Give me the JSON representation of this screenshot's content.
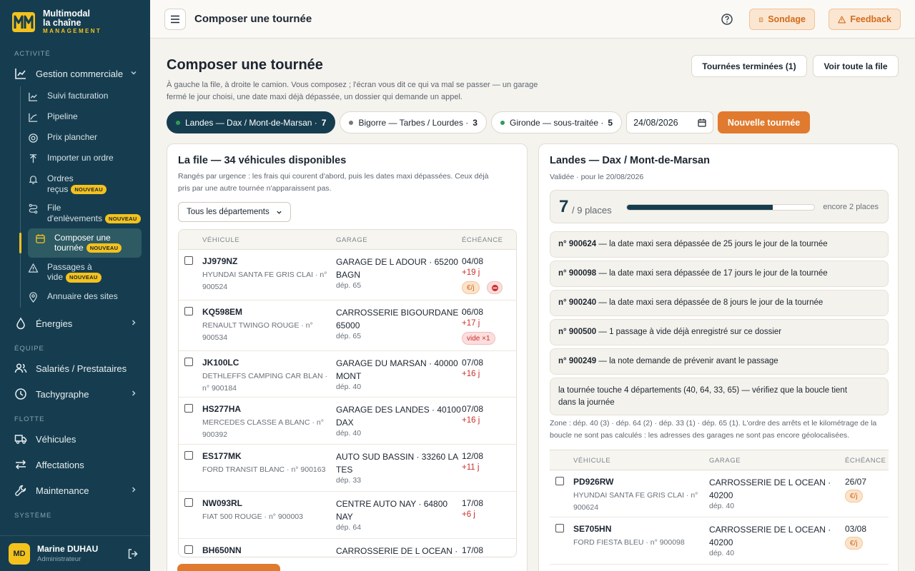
{
  "brand": {
    "name_line1": "Multimodal",
    "name_line2": "la chaîne",
    "sub": "MANAGEMENT",
    "logo_text": "MM"
  },
  "sidebar": {
    "sections": {
      "activite": "ACTIVITÉ",
      "equipe": "ÉQUIPE",
      "flotte": "FLOTTE",
      "systeme": "SYSTÈME"
    },
    "gestion": "Gestion commerciale",
    "sub_items": [
      {
        "label": "Suivi facturation",
        "icon": "chart-line-icon"
      },
      {
        "label": "Pipeline",
        "icon": "trend-icon"
      },
      {
        "label": "Prix plancher",
        "icon": "target-icon"
      },
      {
        "label": "Importer un ordre",
        "icon": "upload-icon"
      },
      {
        "label_line1": "Ordres",
        "label_line2": "reçus",
        "badge": "NOUVEAU",
        "icon": "bell-icon"
      },
      {
        "label_line1": "File",
        "label_line2": "d'enlèvements",
        "badge": "NOUVEAU",
        "icon": "route-icon"
      },
      {
        "label_line1": "Composer une",
        "label_line2": "tournée",
        "badge": "NOUVEAU",
        "icon": "calendar-icon"
      },
      {
        "label_line1": "Passages à",
        "label_line2": "vide",
        "badge": "NOUVEAU",
        "icon": "warning-icon"
      },
      {
        "label": "Annuaire des sites",
        "icon": "pin-icon"
      }
    ],
    "energies": "Énergies",
    "salaries": "Salariés / Prestataires",
    "tachygraphe": "Tachygraphe",
    "vehicules": "Véhicules",
    "affectations": "Affectations",
    "maintenance": "Maintenance"
  },
  "user": {
    "initials": "MD",
    "name": "Marine DUHAU",
    "role": "Administrateur"
  },
  "topbar": {
    "title": "Composer une tournée",
    "sondage": "Sondage",
    "feedback": "Feedback"
  },
  "page": {
    "title": "Composer une tournée",
    "desc": "À gauche la file, à droite le camion. Vous composez ; l'écran vous dit ce qui va mal se passer — un garage fermé le jour choisi, une date maxi déjà dépassée, un dossier qui demande un appel.",
    "btn_terminees": "Tournées terminées (1)",
    "btn_file": "Voir toute la file",
    "chips": [
      {
        "label": "Landes — Dax / Mont-de-Marsan ·",
        "count": "7",
        "dot": "#2e9d5b"
      },
      {
        "label": "Bigorre — Tarbes / Lourdes ·",
        "count": "3",
        "dot": "#777777"
      },
      {
        "label": "Gironde — sous-traitée ·",
        "count": "5",
        "dot": "#2e9d5b"
      }
    ],
    "date": "24/08/2026",
    "new_btn": "Nouvelle tournée"
  },
  "queue": {
    "title": "La file — 34 véhicules disponibles",
    "sub_line1": "Rangés par urgence : les frais qui courent d'abord, puis les dates maxi dépassées. Ceux déjà",
    "sub_line2": "pris par une autre tournée n'apparaissent pas.",
    "filter": "Tous les départements",
    "headers": {
      "vehicle": "VÉHICULE",
      "garage": "GARAGE",
      "due": "ÉCHÉANCE"
    },
    "rows": [
      {
        "plate": "JJ979NZ",
        "desc1": "HYUNDAI SANTA FE GRIS CLAI · n°",
        "desc2": "900524",
        "garage1": "GARAGE DE L ADOUR · 65200",
        "garage2": "BAGN",
        "dep": "dép. 65",
        "date": "04/08",
        "late": "+19 j",
        "badges": [
          "€/j",
          "stop"
        ]
      },
      {
        "plate": "KQ598EM",
        "desc1": "RENAULT TWINGO ROUGE · n°",
        "desc2": "900534",
        "garage1": "CARROSSERIE BIGOURDANE ·",
        "garage2": "65000",
        "dep": "dép. 65",
        "date": "06/08",
        "late": "+17 j",
        "badges": [
          "vide ×1"
        ]
      },
      {
        "plate": "JK100LC",
        "desc1": "DETHLEFFS CAMPING CAR BLAN ·",
        "desc2": "n° 900184",
        "garage1": "GARAGE DU MARSAN · 40000",
        "garage2": "MONT",
        "dep": "dép. 40",
        "date": "07/08",
        "late": "+16 j",
        "badges": []
      },
      {
        "plate": "HS277HA",
        "desc1": "MERCEDES CLASSE A BLANC · n°",
        "desc2": "900392",
        "garage1": "GARAGE DES LANDES · 40100",
        "garage2": "DAX",
        "dep": "dép. 40",
        "date": "07/08",
        "late": "+16 j",
        "badges": []
      },
      {
        "plate": "ES177MK",
        "desc1": "FORD TRANSIT BLANC · n° 900163",
        "desc2": "",
        "garage1": "AUTO SUD BASSIN · 33260 LA",
        "garage2": "TES",
        "dep": "dép. 33",
        "date": "12/08",
        "late": "+11 j",
        "badges": []
      },
      {
        "plate": "NW093RL",
        "desc1": "FIAT 500 ROUGE · n° 900003",
        "desc2": "",
        "garage1": "CENTRE AUTO NAY · 64800",
        "garage2": "NAY",
        "dep": "dép. 64",
        "date": "17/08",
        "late": "+6 j",
        "badges": []
      },
      {
        "plate": "BH650NN",
        "desc1": "",
        "desc2": "",
        "garage1": "CARROSSERIE DE L OCEAN ·",
        "garage2": "",
        "dep": "",
        "date": "17/08",
        "late": "",
        "badges": []
      }
    ]
  },
  "tour": {
    "title": "Landes — Dax / Mont-de-Marsan",
    "sub": "Validée · pour le 20/08/2026",
    "filled": "7",
    "places": "/ 9 places",
    "fill_fraction": 0.78,
    "left": "encore 2 places",
    "warnings": [
      {
        "bold": "n° 900624",
        "text": " — la date maxi sera dépassée de 25 jours le jour de la tournée"
      },
      {
        "bold": "n° 900098",
        "text": " — la date maxi sera dépassée de 17 jours le jour de la tournée"
      },
      {
        "bold": "n° 900240",
        "text": " — la date maxi sera dépassée de 8 jours le jour de la tournée"
      },
      {
        "bold": "n° 900500",
        "text": " — 1 passage à vide déjà enregistré sur ce dossier"
      },
      {
        "bold": "n° 900249",
        "text": " — la note demande de prévenir avant le passage"
      }
    ],
    "warning_long_1": "la tournée touche 4 départements (40, 64, 33, 65) — vérifiez que la boucle tient",
    "warning_long_2": "dans la journée",
    "zone_1": "Zone : dép. 40 (3) · dép. 64 (2) · dép. 33 (1) · dép. 65 (1). L'ordre des arrêts et le kilométrage de la",
    "zone_2": "boucle ne sont pas calculés : les adresses des garages ne sont pas encore géolocalisées.",
    "rows": [
      {
        "plate": "PD926RW",
        "desc1": "HYUNDAI SANTA FE GRIS CLAI · n°",
        "desc2": "900624",
        "garage1": "CARROSSERIE DE L OCEAN ·",
        "garage2": "40200",
        "dep": "dép. 40",
        "date": "26/07",
        "badge": "€/j"
      },
      {
        "plate": "SE705HN",
        "desc1": "FORD FIESTA BLEU · n° 900098",
        "desc2": "",
        "garage1": "CARROSSERIE DE L OCEAN ·",
        "garage2": "40200",
        "dep": "dép. 40",
        "date": "03/08",
        "badge": "€/j"
      }
    ]
  }
}
